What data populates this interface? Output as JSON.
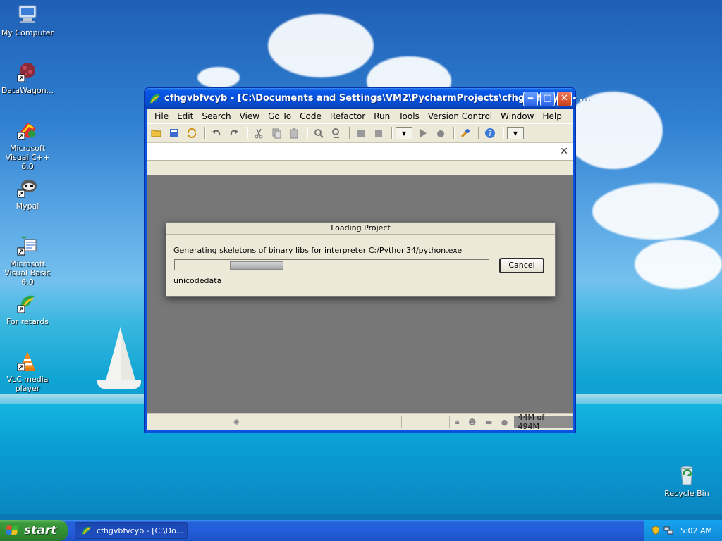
{
  "desktop": {
    "icons": [
      {
        "label": "My Computer",
        "icon": "my-computer-icon"
      },
      {
        "label": "DataWagon...",
        "icon": "datawagon-icon"
      },
      {
        "label": "Microsoft Visual C++ 6.0",
        "icon": "visual-cpp-icon"
      },
      {
        "label": "Mypal",
        "icon": "mypal-icon"
      },
      {
        "label": "Microsoft Visual Basic 6.0",
        "icon": "visual-basic-icon"
      },
      {
        "label": "For retards",
        "icon": "pycharm-icon"
      },
      {
        "label": "VLC media player",
        "icon": "vlc-icon"
      },
      {
        "label": "Recycle Bin",
        "icon": "recycle-bin-icon"
      }
    ]
  },
  "window": {
    "title": "cfhgvbfvcyb - [C:\\Documents and Settings\\VM2\\PycharmProjects\\cfhgvbfvcyb] - ...",
    "menu": [
      "File",
      "Edit",
      "Search",
      "View",
      "Go To",
      "Code",
      "Refactor",
      "Run",
      "Tools",
      "Version Control",
      "Window",
      "Help"
    ],
    "close_glyph": "✕",
    "memory": "44M of 494M"
  },
  "dialog": {
    "title": "Loading Project",
    "message": "Generating skeletons of binary libs for interpreter C:/Python34/python.exe",
    "sub": "unicodedata",
    "cancel_label": "Cancel",
    "progress_position": 0.17
  },
  "taskbar": {
    "start_label": "start",
    "task_label": "cfhgvbfvcyb - [C:\\Do...",
    "clock": "5:02 AM"
  },
  "colors": {
    "title_blue": "#0a5ae8",
    "start_green": "#3c9a3c",
    "workarea_gray": "#777777"
  }
}
